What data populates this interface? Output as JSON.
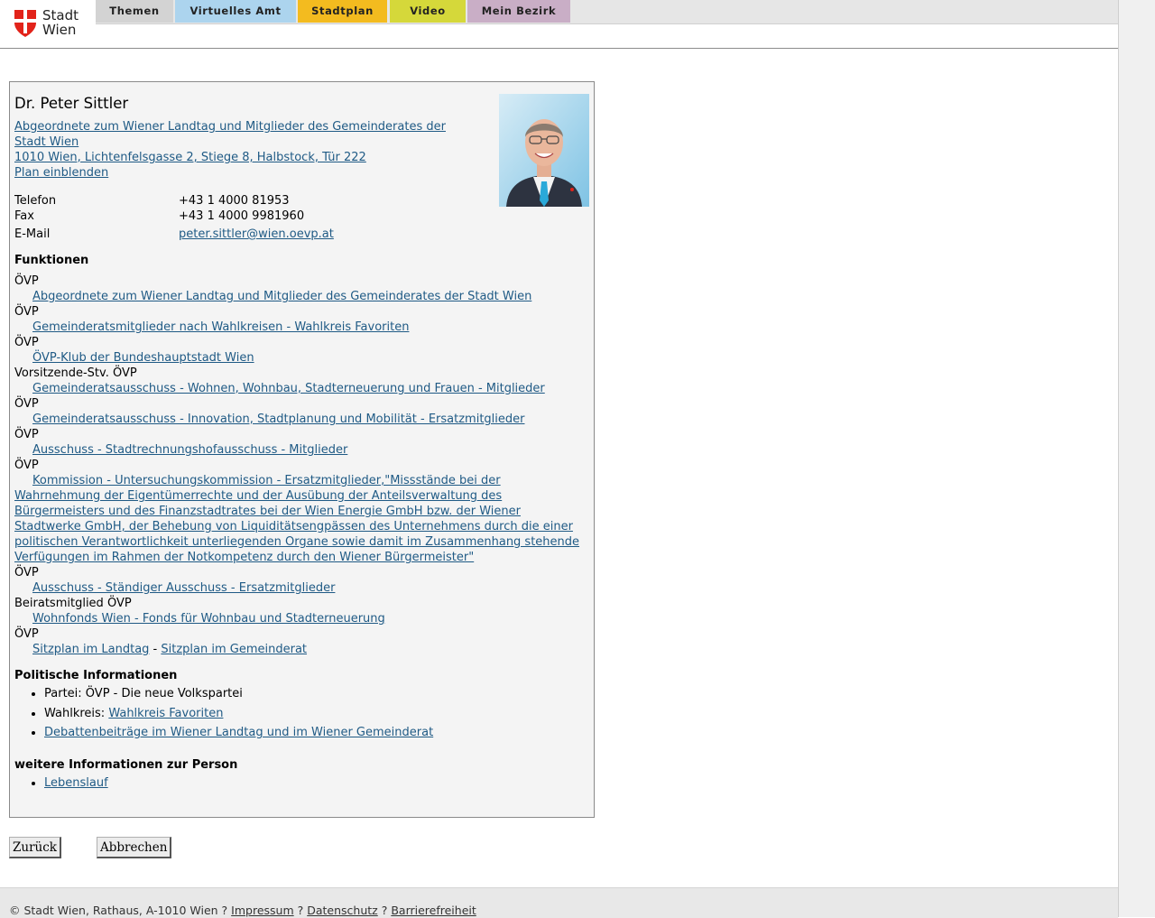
{
  "nav": {
    "logo_line1": "Stadt",
    "logo_line2": "Wien",
    "tabs": [
      {
        "label": "Themen",
        "color": "#d3d3d3"
      },
      {
        "label": "Virtuelles Amt",
        "color": "#acd4ee"
      },
      {
        "label": "Stadtplan",
        "color": "#f3bb1f"
      },
      {
        "label": "Video",
        "color": "#d5d83a"
      },
      {
        "label": "Mein Bezirk",
        "color": "#c9aec6"
      }
    ]
  },
  "person": {
    "name": "Dr. Peter Sittler",
    "role_link": "Abgeordnete zum Wiener Landtag und Mitglieder des Gemeinderates der Stadt Wien ",
    "address_link": "1010 Wien, Lichtenfelsgasse 2, Stiege 8, Halbstock, Tür 222",
    "plan_link": "Plan einblenden",
    "contact": {
      "phone_label": "Telefon",
      "phone": "+43 1 4000 81953",
      "fax_label": "Fax",
      "fax": "+43 1 4000 9981960",
      "email_label": "E-Mail",
      "email": "peter.sittler@wien.oevp.at"
    }
  },
  "functions": {
    "title": "Funktionen",
    "items": [
      {
        "party": "ÖVP",
        "link": "Abgeordnete zum Wiener Landtag und Mitglieder des Gemeinderates der Stadt Wien"
      },
      {
        "party": "ÖVP",
        "link": "Gemeinderatsmitglieder nach Wahlkreisen - Wahlkreis Favoriten"
      },
      {
        "party": "ÖVP",
        "link": "ÖVP-Klub der Bundeshauptstadt Wien"
      },
      {
        "party": "Vorsitzende-Stv. ÖVP",
        "link": "Gemeinderatsausschuss - Wohnen, Wohnbau, Stadterneuerung und Frauen - Mitglieder"
      },
      {
        "party": "ÖVP",
        "link": "Gemeinderatsausschuss - Innovation, Stadtplanung und Mobilität - Ersatzmitglieder"
      },
      {
        "party": "ÖVP",
        "link": "Ausschuss - Stadtrechnungshofausschuss - Mitglieder"
      },
      {
        "party": "ÖVP",
        "link": "Kommission - Untersuchungskommission - Ersatzmitglieder,\"Missstände bei der Wahrnehmung der Eigentümerrechte und der Ausübung der Anteilsverwaltung des Bürgermeisters und des Finanzstadtrates bei der Wien Energie GmbH bzw. der Wiener Stadtwerke GmbH, der Behebung von Liquiditätsengpässen des Unternehmens durch die einer politischen Verantwortlichkeit unterliegenden Organe sowie damit im Zusammenhang stehende Verfügungen im Rahmen der Notkompetenz durch den Wiener Bürgermeister\""
      },
      {
        "party": "ÖVP",
        "link": "Ausschuss - Ständiger Ausschuss - Ersatzmitglieder"
      },
      {
        "party": "Beiratsmitglied ÖVP",
        "link": "Wohnfonds Wien - Fonds für Wohnbau und Stadterneuerung"
      }
    ],
    "last_party": "ÖVP",
    "seat_landtag": "Sitzplan im Landtag",
    "seat_separator": " - ",
    "seat_gemeinderat": "Sitzplan im Gemeinderat"
  },
  "political": {
    "title": "Politische Informationen",
    "party_label": "Partei: ",
    "party_value": "ÖVP - Die neue Volkspartei",
    "district_label": "Wahlkreis: ",
    "district_link": "Wahlkreis Favoriten",
    "debates_link": "Debattenbeiträge im Wiener Landtag und im Wiener Gemeinderat"
  },
  "more_info": {
    "title": "weitere Informationen zur Person",
    "cv_link": "Lebenslauf"
  },
  "buttons": {
    "back": "Zurück",
    "cancel": "Abbrechen"
  },
  "footer": {
    "copyright": "© Stadt Wien, Rathaus, A-1010 Wien ? ",
    "impressum": "Impressum",
    "sep1": " ? ",
    "datenschutz": "Datenschutz",
    "sep2": " ? ",
    "barrierefreiheit": "Barrierefreiheit"
  }
}
